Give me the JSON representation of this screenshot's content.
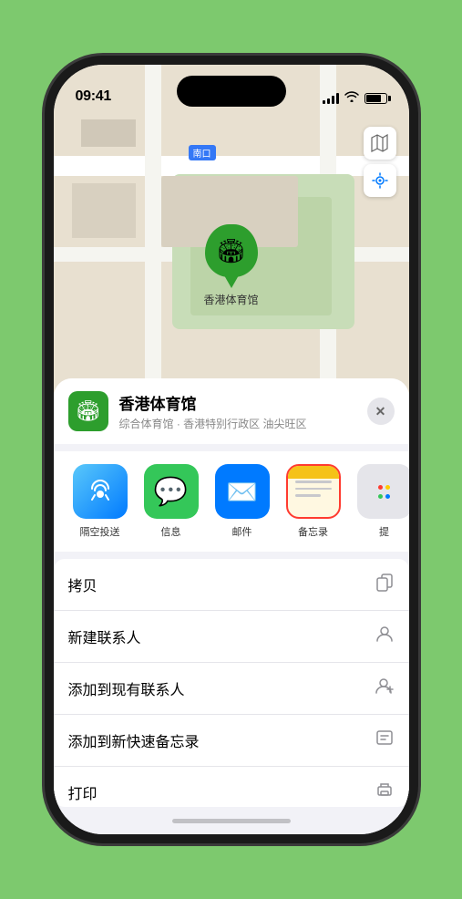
{
  "status_bar": {
    "time": "09:41",
    "location_arrow": "▶"
  },
  "map": {
    "label_tag": "南口",
    "venue_label": "香港体育馆"
  },
  "venue_card": {
    "name": "香港体育馆",
    "desc": "综合体育馆 · 香港特别行政区 油尖旺区",
    "close_label": "✕"
  },
  "share_items": [
    {
      "id": "airdrop",
      "label": "隔空投送",
      "type": "airdrop"
    },
    {
      "id": "messages",
      "label": "信息",
      "type": "messages"
    },
    {
      "id": "mail",
      "label": "邮件",
      "type": "mail"
    },
    {
      "id": "notes",
      "label": "备忘录",
      "type": "notes"
    },
    {
      "id": "more",
      "label": "提",
      "type": "more"
    }
  ],
  "actions": [
    {
      "id": "copy",
      "label": "拷贝",
      "icon": "📋"
    },
    {
      "id": "new-contact",
      "label": "新建联系人",
      "icon": "👤"
    },
    {
      "id": "add-contact",
      "label": "添加到现有联系人",
      "icon": "👤"
    },
    {
      "id": "add-notes",
      "label": "添加到新快速备忘录",
      "icon": "📝"
    },
    {
      "id": "print",
      "label": "打印",
      "icon": "🖨"
    }
  ]
}
